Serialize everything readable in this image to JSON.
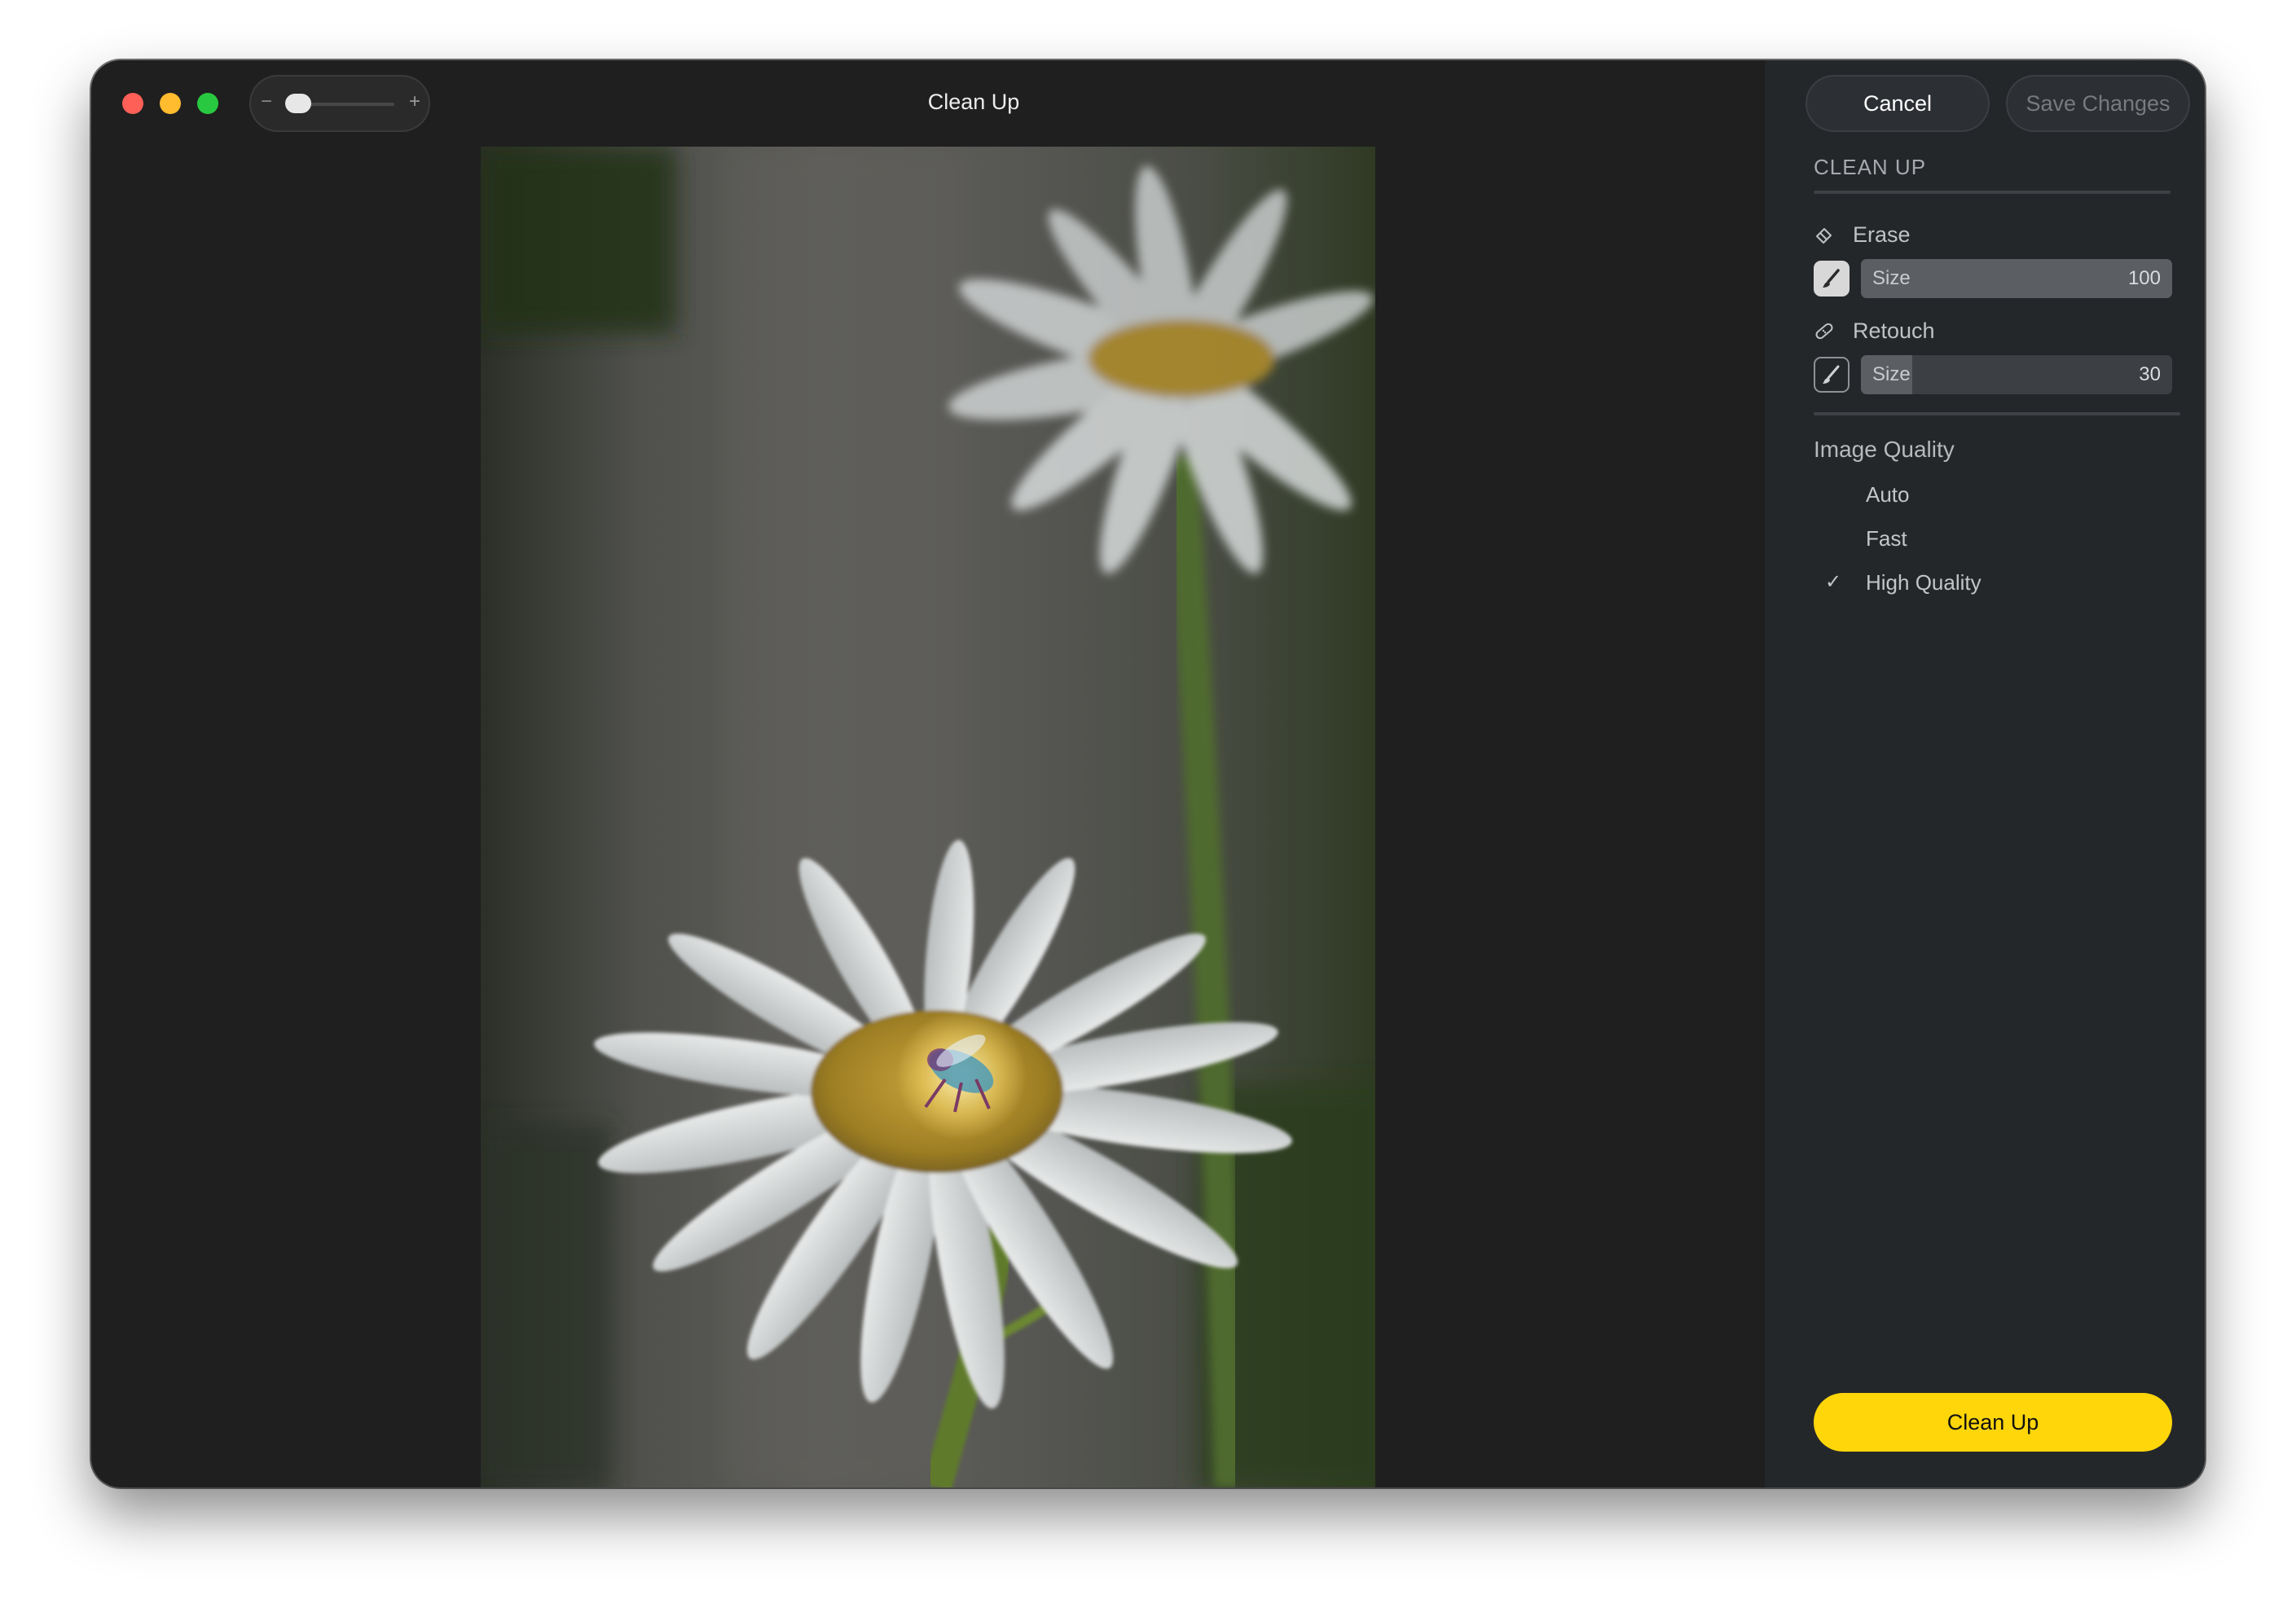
{
  "window": {
    "title": "Clean Up",
    "traffic_lights": {
      "close_color": "#fe5f57",
      "minimize_color": "#febc2e",
      "zoom_color": "#28c840"
    },
    "zoom_control": {
      "minus": "−",
      "plus": "+",
      "level": 0.15
    }
  },
  "photo": {
    "subject": "daisy-flowers-with-insect-selection"
  },
  "sidebar": {
    "cancel_label": "Cancel",
    "save_label": "Save Changes",
    "section_title": "CLEAN UP",
    "erase": {
      "label": "Erase",
      "icon": "eraser-icon",
      "brush_icon": "brush-icon",
      "size_label": "Size",
      "size_value": "100",
      "size_fraction": 1.0
    },
    "retouch": {
      "label": "Retouch",
      "icon": "bandage-icon",
      "brush_icon": "brush-icon",
      "size_label": "Size",
      "size_value": "30",
      "size_fraction": 0.3
    },
    "image_quality": {
      "title": "Image Quality",
      "options": [
        {
          "label": "Auto",
          "check": ""
        },
        {
          "label": "Fast",
          "check": ""
        },
        {
          "label": "High Quality",
          "check": "✓"
        }
      ],
      "selected": "High Quality"
    },
    "primary_label": "Clean Up",
    "accent_color": "#ffd60a"
  }
}
